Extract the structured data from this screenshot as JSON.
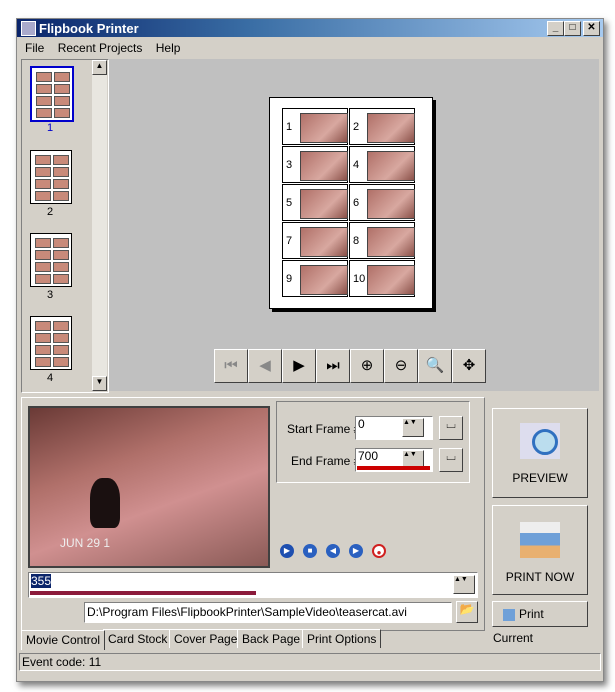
{
  "window": {
    "title": "Flipbook Printer"
  },
  "menu": [
    "File",
    "Recent Projects",
    "Help"
  ],
  "thumbnails": [
    "1",
    "2",
    "3",
    "4"
  ],
  "page_cells": [
    "1",
    "2",
    "3",
    "4",
    "5",
    "6",
    "7",
    "8",
    "9",
    "10"
  ],
  "frames": {
    "start_label": "Start Frame #",
    "start_value": "0",
    "end_label": "End Frame #",
    "end_value": "700"
  },
  "video": {
    "timestamp": "JUN 29 1"
  },
  "position": {
    "value": "355",
    "progress": 0.51
  },
  "file_path": "D:\\Program Files\\FlipbookPrinter\\SampleVideo\\teasercat.avi",
  "buttons": {
    "preview": "PREVIEW",
    "print_now": "PRINT NOW",
    "print_current": "Print Current"
  },
  "tabs": [
    "Movie Control",
    "Card Stock",
    "Cover Page",
    "Back Page",
    "Print Options"
  ],
  "status": "Event code: 11",
  "colors": {
    "progress": "#8b1a3a",
    "end_bar": "#cc0000"
  }
}
